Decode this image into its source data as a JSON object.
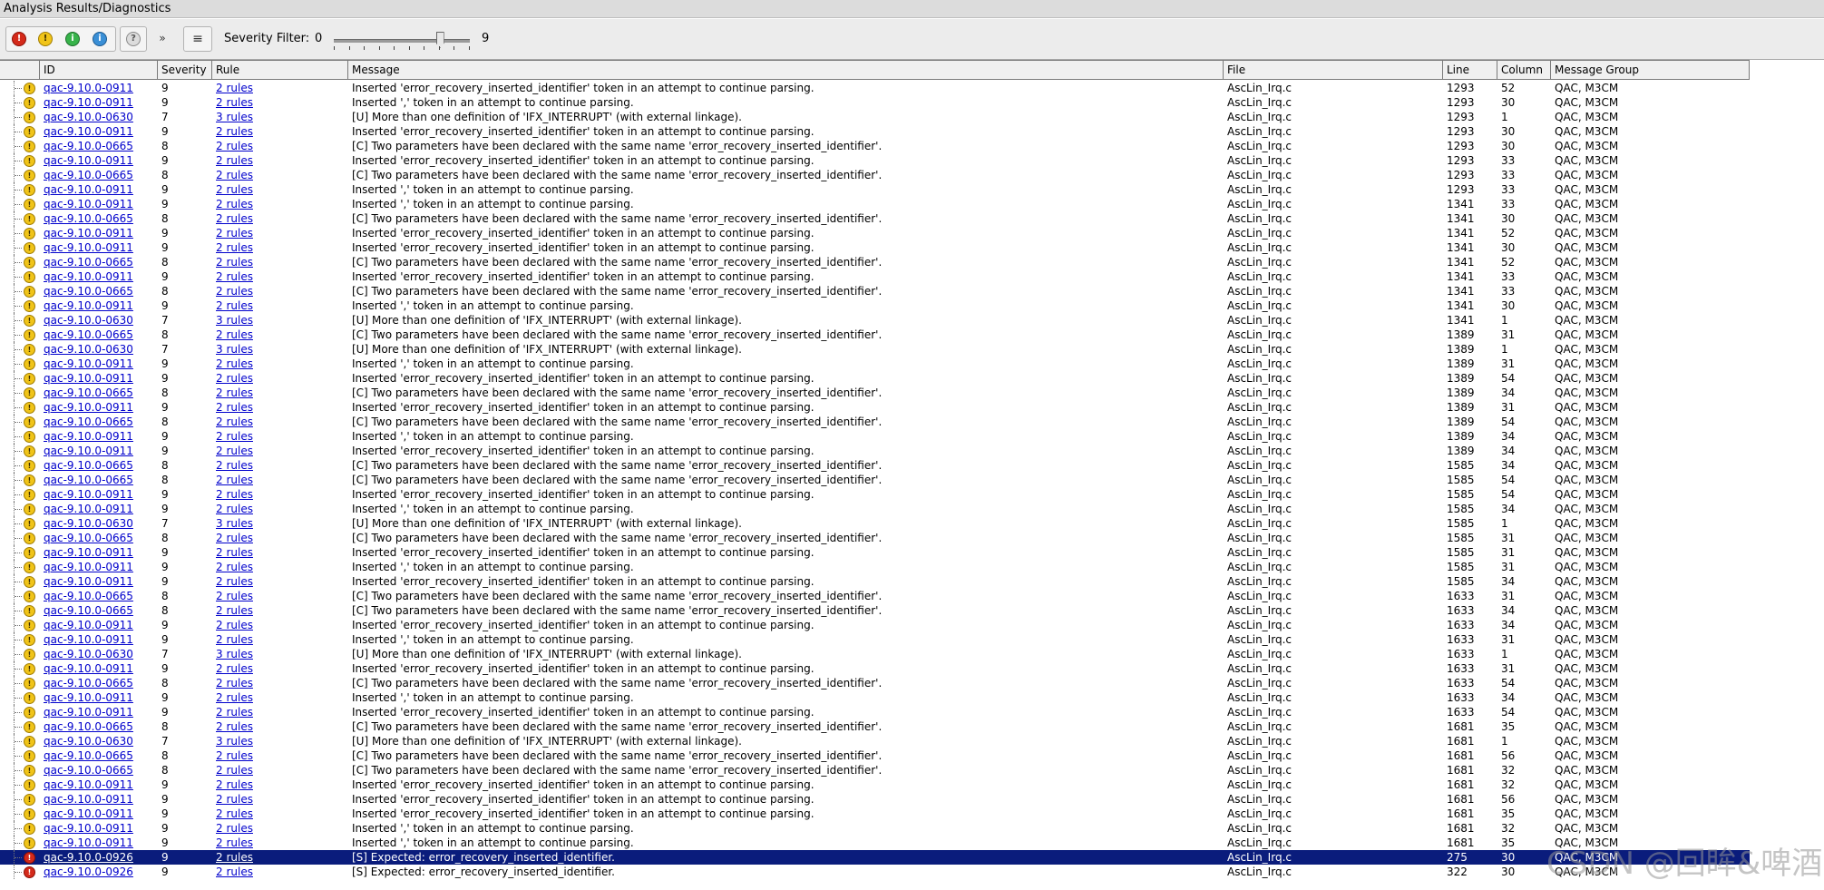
{
  "window": {
    "title": "Analysis Results/Diagnostics"
  },
  "toolbar": {
    "severity_label": "Severity Filter:",
    "severity_min": "0",
    "severity_max": "9",
    "severity_value": 7,
    "buttons": [
      {
        "icon": "error-red-icon",
        "glyph": "!"
      },
      {
        "icon": "warning-yellow-icon",
        "glyph": "!"
      },
      {
        "icon": "info-green-icon",
        "glyph": "i"
      },
      {
        "icon": "message-blue-icon",
        "glyph": "i"
      },
      {
        "icon": "help-grey-icon",
        "glyph": "?"
      },
      {
        "icon": "more-chevron-icon",
        "glyph": "»"
      },
      {
        "icon": "list-menu-icon",
        "glyph": "≡"
      }
    ]
  },
  "columns": [
    "ID",
    "Severity",
    "Rule",
    "Message",
    "File",
    "Line",
    "Column",
    "Message Group"
  ],
  "colors": {
    "selected": "#0a1c7c",
    "link": "#0000cc"
  },
  "messages": {
    "m911a": "Inserted 'error_recovery_inserted_identifier' token in an attempt to continue parsing.",
    "m911b": "Inserted ',' token in an attempt to continue parsing.",
    "m630": "[U] More than one definition of 'IFX_INTERRUPT' (with external linkage).",
    "m665": "[C] Two parameters have been declared with the same name 'error_recovery_inserted_identifier'.",
    "m926": "[S] Expected: error_recovery_inserted_identifier."
  },
  "rows": [
    {
      "id": "qac-9.10.0-0911",
      "sev": "9",
      "rule": "2 rules",
      "msg": "Inserted 'error_recovery_inserted_identifier' token in an attempt to continue parsing.",
      "file": "AscLin_Irq.c",
      "line": "1293",
      "col": "52",
      "grp": "QAC, M3CM",
      "icon": "warning"
    },
    {
      "id": "qac-9.10.0-0911",
      "sev": "9",
      "rule": "2 rules",
      "msg": "Inserted ',' token in an attempt to continue parsing.",
      "file": "AscLin_Irq.c",
      "line": "1293",
      "col": "30",
      "grp": "QAC, M3CM",
      "icon": "warning"
    },
    {
      "id": "qac-9.10.0-0630",
      "sev": "7",
      "rule": "3 rules",
      "msg": "[U] More than one definition of 'IFX_INTERRUPT' (with external linkage).",
      "file": "AscLin_Irq.c",
      "line": "1293",
      "col": "1",
      "grp": "QAC, M3CM",
      "icon": "warning"
    },
    {
      "id": "qac-9.10.0-0911",
      "sev": "9",
      "rule": "2 rules",
      "msg": "Inserted 'error_recovery_inserted_identifier' token in an attempt to continue parsing.",
      "file": "AscLin_Irq.c",
      "line": "1293",
      "col": "30",
      "grp": "QAC, M3CM",
      "icon": "warning"
    },
    {
      "id": "qac-9.10.0-0665",
      "sev": "8",
      "rule": "2 rules",
      "msg": "[C] Two parameters have been declared with the same name 'error_recovery_inserted_identifier'.",
      "file": "AscLin_Irq.c",
      "line": "1293",
      "col": "30",
      "grp": "QAC, M3CM",
      "icon": "warning"
    },
    {
      "id": "qac-9.10.0-0911",
      "sev": "9",
      "rule": "2 rules",
      "msg": "Inserted 'error_recovery_inserted_identifier' token in an attempt to continue parsing.",
      "file": "AscLin_Irq.c",
      "line": "1293",
      "col": "33",
      "grp": "QAC, M3CM",
      "icon": "warning"
    },
    {
      "id": "qac-9.10.0-0665",
      "sev": "8",
      "rule": "2 rules",
      "msg": "[C] Two parameters have been declared with the same name 'error_recovery_inserted_identifier'.",
      "file": "AscLin_Irq.c",
      "line": "1293",
      "col": "33",
      "grp": "QAC, M3CM",
      "icon": "warning"
    },
    {
      "id": "qac-9.10.0-0911",
      "sev": "9",
      "rule": "2 rules",
      "msg": "Inserted ',' token in an attempt to continue parsing.",
      "file": "AscLin_Irq.c",
      "line": "1293",
      "col": "33",
      "grp": "QAC, M3CM",
      "icon": "warning"
    },
    {
      "id": "qac-9.10.0-0911",
      "sev": "9",
      "rule": "2 rules",
      "msg": "Inserted ',' token in an attempt to continue parsing.",
      "file": "AscLin_Irq.c",
      "line": "1341",
      "col": "33",
      "grp": "QAC, M3CM",
      "icon": "warning"
    },
    {
      "id": "qac-9.10.0-0665",
      "sev": "8",
      "rule": "2 rules",
      "msg": "[C] Two parameters have been declared with the same name 'error_recovery_inserted_identifier'.",
      "file": "AscLin_Irq.c",
      "line": "1341",
      "col": "30",
      "grp": "QAC, M3CM",
      "icon": "warning"
    },
    {
      "id": "qac-9.10.0-0911",
      "sev": "9",
      "rule": "2 rules",
      "msg": "Inserted 'error_recovery_inserted_identifier' token in an attempt to continue parsing.",
      "file": "AscLin_Irq.c",
      "line": "1341",
      "col": "52",
      "grp": "QAC, M3CM",
      "icon": "warning"
    },
    {
      "id": "qac-9.10.0-0911",
      "sev": "9",
      "rule": "2 rules",
      "msg": "Inserted 'error_recovery_inserted_identifier' token in an attempt to continue parsing.",
      "file": "AscLin_Irq.c",
      "line": "1341",
      "col": "30",
      "grp": "QAC, M3CM",
      "icon": "warning"
    },
    {
      "id": "qac-9.10.0-0665",
      "sev": "8",
      "rule": "2 rules",
      "msg": "[C] Two parameters have been declared with the same name 'error_recovery_inserted_identifier'.",
      "file": "AscLin_Irq.c",
      "line": "1341",
      "col": "52",
      "grp": "QAC, M3CM",
      "icon": "warning"
    },
    {
      "id": "qac-9.10.0-0911",
      "sev": "9",
      "rule": "2 rules",
      "msg": "Inserted 'error_recovery_inserted_identifier' token in an attempt to continue parsing.",
      "file": "AscLin_Irq.c",
      "line": "1341",
      "col": "33",
      "grp": "QAC, M3CM",
      "icon": "warning"
    },
    {
      "id": "qac-9.10.0-0665",
      "sev": "8",
      "rule": "2 rules",
      "msg": "[C] Two parameters have been declared with the same name 'error_recovery_inserted_identifier'.",
      "file": "AscLin_Irq.c",
      "line": "1341",
      "col": "33",
      "grp": "QAC, M3CM",
      "icon": "warning"
    },
    {
      "id": "qac-9.10.0-0911",
      "sev": "9",
      "rule": "2 rules",
      "msg": "Inserted ',' token in an attempt to continue parsing.",
      "file": "AscLin_Irq.c",
      "line": "1341",
      "col": "30",
      "grp": "QAC, M3CM",
      "icon": "warning"
    },
    {
      "id": "qac-9.10.0-0630",
      "sev": "7",
      "rule": "3 rules",
      "msg": "[U] More than one definition of 'IFX_INTERRUPT' (with external linkage).",
      "file": "AscLin_Irq.c",
      "line": "1341",
      "col": "1",
      "grp": "QAC, M3CM",
      "icon": "warning"
    },
    {
      "id": "qac-9.10.0-0665",
      "sev": "8",
      "rule": "2 rules",
      "msg": "[C] Two parameters have been declared with the same name 'error_recovery_inserted_identifier'.",
      "file": "AscLin_Irq.c",
      "line": "1389",
      "col": "31",
      "grp": "QAC, M3CM",
      "icon": "warning"
    },
    {
      "id": "qac-9.10.0-0630",
      "sev": "7",
      "rule": "3 rules",
      "msg": "[U] More than one definition of 'IFX_INTERRUPT' (with external linkage).",
      "file": "AscLin_Irq.c",
      "line": "1389",
      "col": "1",
      "grp": "QAC, M3CM",
      "icon": "warning"
    },
    {
      "id": "qac-9.10.0-0911",
      "sev": "9",
      "rule": "2 rules",
      "msg": "Inserted ',' token in an attempt to continue parsing.",
      "file": "AscLin_Irq.c",
      "line": "1389",
      "col": "31",
      "grp": "QAC, M3CM",
      "icon": "warning"
    },
    {
      "id": "qac-9.10.0-0911",
      "sev": "9",
      "rule": "2 rules",
      "msg": "Inserted 'error_recovery_inserted_identifier' token in an attempt to continue parsing.",
      "file": "AscLin_Irq.c",
      "line": "1389",
      "col": "54",
      "grp": "QAC, M3CM",
      "icon": "warning"
    },
    {
      "id": "qac-9.10.0-0665",
      "sev": "8",
      "rule": "2 rules",
      "msg": "[C] Two parameters have been declared with the same name 'error_recovery_inserted_identifier'.",
      "file": "AscLin_Irq.c",
      "line": "1389",
      "col": "34",
      "grp": "QAC, M3CM",
      "icon": "warning"
    },
    {
      "id": "qac-9.10.0-0911",
      "sev": "9",
      "rule": "2 rules",
      "msg": "Inserted 'error_recovery_inserted_identifier' token in an attempt to continue parsing.",
      "file": "AscLin_Irq.c",
      "line": "1389",
      "col": "31",
      "grp": "QAC, M3CM",
      "icon": "warning"
    },
    {
      "id": "qac-9.10.0-0665",
      "sev": "8",
      "rule": "2 rules",
      "msg": "[C] Two parameters have been declared with the same name 'error_recovery_inserted_identifier'.",
      "file": "AscLin_Irq.c",
      "line": "1389",
      "col": "54",
      "grp": "QAC, M3CM",
      "icon": "warning"
    },
    {
      "id": "qac-9.10.0-0911",
      "sev": "9",
      "rule": "2 rules",
      "msg": "Inserted ',' token in an attempt to continue parsing.",
      "file": "AscLin_Irq.c",
      "line": "1389",
      "col": "34",
      "grp": "QAC, M3CM",
      "icon": "warning"
    },
    {
      "id": "qac-9.10.0-0911",
      "sev": "9",
      "rule": "2 rules",
      "msg": "Inserted 'error_recovery_inserted_identifier' token in an attempt to continue parsing.",
      "file": "AscLin_Irq.c",
      "line": "1389",
      "col": "34",
      "grp": "QAC, M3CM",
      "icon": "warning"
    },
    {
      "id": "qac-9.10.0-0665",
      "sev": "8",
      "rule": "2 rules",
      "msg": "[C] Two parameters have been declared with the same name 'error_recovery_inserted_identifier'.",
      "file": "AscLin_Irq.c",
      "line": "1585",
      "col": "34",
      "grp": "QAC, M3CM",
      "icon": "warning"
    },
    {
      "id": "qac-9.10.0-0665",
      "sev": "8",
      "rule": "2 rules",
      "msg": "[C] Two parameters have been declared with the same name 'error_recovery_inserted_identifier'.",
      "file": "AscLin_Irq.c",
      "line": "1585",
      "col": "54",
      "grp": "QAC, M3CM",
      "icon": "warning"
    },
    {
      "id": "qac-9.10.0-0911",
      "sev": "9",
      "rule": "2 rules",
      "msg": "Inserted 'error_recovery_inserted_identifier' token in an attempt to continue parsing.",
      "file": "AscLin_Irq.c",
      "line": "1585",
      "col": "54",
      "grp": "QAC, M3CM",
      "icon": "warning"
    },
    {
      "id": "qac-9.10.0-0911",
      "sev": "9",
      "rule": "2 rules",
      "msg": "Inserted ',' token in an attempt to continue parsing.",
      "file": "AscLin_Irq.c",
      "line": "1585",
      "col": "34",
      "grp": "QAC, M3CM",
      "icon": "warning"
    },
    {
      "id": "qac-9.10.0-0630",
      "sev": "7",
      "rule": "3 rules",
      "msg": "[U] More than one definition of 'IFX_INTERRUPT' (with external linkage).",
      "file": "AscLin_Irq.c",
      "line": "1585",
      "col": "1",
      "grp": "QAC, M3CM",
      "icon": "warning"
    },
    {
      "id": "qac-9.10.0-0665",
      "sev": "8",
      "rule": "2 rules",
      "msg": "[C] Two parameters have been declared with the same name 'error_recovery_inserted_identifier'.",
      "file": "AscLin_Irq.c",
      "line": "1585",
      "col": "31",
      "grp": "QAC, M3CM",
      "icon": "warning"
    },
    {
      "id": "qac-9.10.0-0911",
      "sev": "9",
      "rule": "2 rules",
      "msg": "Inserted 'error_recovery_inserted_identifier' token in an attempt to continue parsing.",
      "file": "AscLin_Irq.c",
      "line": "1585",
      "col": "31",
      "grp": "QAC, M3CM",
      "icon": "warning"
    },
    {
      "id": "qac-9.10.0-0911",
      "sev": "9",
      "rule": "2 rules",
      "msg": "Inserted ',' token in an attempt to continue parsing.",
      "file": "AscLin_Irq.c",
      "line": "1585",
      "col": "31",
      "grp": "QAC, M3CM",
      "icon": "warning"
    },
    {
      "id": "qac-9.10.0-0911",
      "sev": "9",
      "rule": "2 rules",
      "msg": "Inserted 'error_recovery_inserted_identifier' token in an attempt to continue parsing.",
      "file": "AscLin_Irq.c",
      "line": "1585",
      "col": "34",
      "grp": "QAC, M3CM",
      "icon": "warning"
    },
    {
      "id": "qac-9.10.0-0665",
      "sev": "8",
      "rule": "2 rules",
      "msg": "[C] Two parameters have been declared with the same name 'error_recovery_inserted_identifier'.",
      "file": "AscLin_Irq.c",
      "line": "1633",
      "col": "31",
      "grp": "QAC, M3CM",
      "icon": "warning"
    },
    {
      "id": "qac-9.10.0-0665",
      "sev": "8",
      "rule": "2 rules",
      "msg": "[C] Two parameters have been declared with the same name 'error_recovery_inserted_identifier'.",
      "file": "AscLin_Irq.c",
      "line": "1633",
      "col": "34",
      "grp": "QAC, M3CM",
      "icon": "warning"
    },
    {
      "id": "qac-9.10.0-0911",
      "sev": "9",
      "rule": "2 rules",
      "msg": "Inserted 'error_recovery_inserted_identifier' token in an attempt to continue parsing.",
      "file": "AscLin_Irq.c",
      "line": "1633",
      "col": "34",
      "grp": "QAC, M3CM",
      "icon": "warning"
    },
    {
      "id": "qac-9.10.0-0911",
      "sev": "9",
      "rule": "2 rules",
      "msg": "Inserted ',' token in an attempt to continue parsing.",
      "file": "AscLin_Irq.c",
      "line": "1633",
      "col": "31",
      "grp": "QAC, M3CM",
      "icon": "warning"
    },
    {
      "id": "qac-9.10.0-0630",
      "sev": "7",
      "rule": "3 rules",
      "msg": "[U] More than one definition of 'IFX_INTERRUPT' (with external linkage).",
      "file": "AscLin_Irq.c",
      "line": "1633",
      "col": "1",
      "grp": "QAC, M3CM",
      "icon": "warning"
    },
    {
      "id": "qac-9.10.0-0911",
      "sev": "9",
      "rule": "2 rules",
      "msg": "Inserted 'error_recovery_inserted_identifier' token in an attempt to continue parsing.",
      "file": "AscLin_Irq.c",
      "line": "1633",
      "col": "31",
      "grp": "QAC, M3CM",
      "icon": "warning"
    },
    {
      "id": "qac-9.10.0-0665",
      "sev": "8",
      "rule": "2 rules",
      "msg": "[C] Two parameters have been declared with the same name 'error_recovery_inserted_identifier'.",
      "file": "AscLin_Irq.c",
      "line": "1633",
      "col": "54",
      "grp": "QAC, M3CM",
      "icon": "warning"
    },
    {
      "id": "qac-9.10.0-0911",
      "sev": "9",
      "rule": "2 rules",
      "msg": "Inserted ',' token in an attempt to continue parsing.",
      "file": "AscLin_Irq.c",
      "line": "1633",
      "col": "34",
      "grp": "QAC, M3CM",
      "icon": "warning"
    },
    {
      "id": "qac-9.10.0-0911",
      "sev": "9",
      "rule": "2 rules",
      "msg": "Inserted 'error_recovery_inserted_identifier' token in an attempt to continue parsing.",
      "file": "AscLin_Irq.c",
      "line": "1633",
      "col": "54",
      "grp": "QAC, M3CM",
      "icon": "warning"
    },
    {
      "id": "qac-9.10.0-0665",
      "sev": "8",
      "rule": "2 rules",
      "msg": "[C] Two parameters have been declared with the same name 'error_recovery_inserted_identifier'.",
      "file": "AscLin_Irq.c",
      "line": "1681",
      "col": "35",
      "grp": "QAC, M3CM",
      "icon": "warning"
    },
    {
      "id": "qac-9.10.0-0630",
      "sev": "7",
      "rule": "3 rules",
      "msg": "[U] More than one definition of 'IFX_INTERRUPT' (with external linkage).",
      "file": "AscLin_Irq.c",
      "line": "1681",
      "col": "1",
      "grp": "QAC, M3CM",
      "icon": "warning"
    },
    {
      "id": "qac-9.10.0-0665",
      "sev": "8",
      "rule": "2 rules",
      "msg": "[C] Two parameters have been declared with the same name 'error_recovery_inserted_identifier'.",
      "file": "AscLin_Irq.c",
      "line": "1681",
      "col": "56",
      "grp": "QAC, M3CM",
      "icon": "warning"
    },
    {
      "id": "qac-9.10.0-0665",
      "sev": "8",
      "rule": "2 rules",
      "msg": "[C] Two parameters have been declared with the same name 'error_recovery_inserted_identifier'.",
      "file": "AscLin_Irq.c",
      "line": "1681",
      "col": "32",
      "grp": "QAC, M3CM",
      "icon": "warning"
    },
    {
      "id": "qac-9.10.0-0911",
      "sev": "9",
      "rule": "2 rules",
      "msg": "Inserted 'error_recovery_inserted_identifier' token in an attempt to continue parsing.",
      "file": "AscLin_Irq.c",
      "line": "1681",
      "col": "32",
      "grp": "QAC, M3CM",
      "icon": "warning"
    },
    {
      "id": "qac-9.10.0-0911",
      "sev": "9",
      "rule": "2 rules",
      "msg": "Inserted 'error_recovery_inserted_identifier' token in an attempt to continue parsing.",
      "file": "AscLin_Irq.c",
      "line": "1681",
      "col": "56",
      "grp": "QAC, M3CM",
      "icon": "warning"
    },
    {
      "id": "qac-9.10.0-0911",
      "sev": "9",
      "rule": "2 rules",
      "msg": "Inserted 'error_recovery_inserted_identifier' token in an attempt to continue parsing.",
      "file": "AscLin_Irq.c",
      "line": "1681",
      "col": "35",
      "grp": "QAC, M3CM",
      "icon": "warning"
    },
    {
      "id": "qac-9.10.0-0911",
      "sev": "9",
      "rule": "2 rules",
      "msg": "Inserted ',' token in an attempt to continue parsing.",
      "file": "AscLin_Irq.c",
      "line": "1681",
      "col": "32",
      "grp": "QAC, M3CM",
      "icon": "warning"
    },
    {
      "id": "qac-9.10.0-0911",
      "sev": "9",
      "rule": "2 rules",
      "msg": "Inserted ',' token in an attempt to continue parsing.",
      "file": "AscLin_Irq.c",
      "line": "1681",
      "col": "35",
      "grp": "QAC, M3CM",
      "icon": "warning"
    },
    {
      "id": "qac-9.10.0-0926",
      "sev": "9",
      "rule": "2 rules",
      "msg": "[S] Expected: error_recovery_inserted_identifier.",
      "file": "AscLin_Irq.c",
      "line": "275",
      "col": "30",
      "grp": "QAC, M3CM",
      "icon": "error",
      "selected": true
    },
    {
      "id": "qac-9.10.0-0926",
      "sev": "9",
      "rule": "2 rules",
      "msg": "[S] Expected: error_recovery_inserted_identifier.",
      "file": "AscLin_Irq.c",
      "line": "322",
      "col": "30",
      "grp": "QAC, M3CM",
      "icon": "error"
    }
  ],
  "watermark": "CSDN @回眸&啤酒鸭"
}
